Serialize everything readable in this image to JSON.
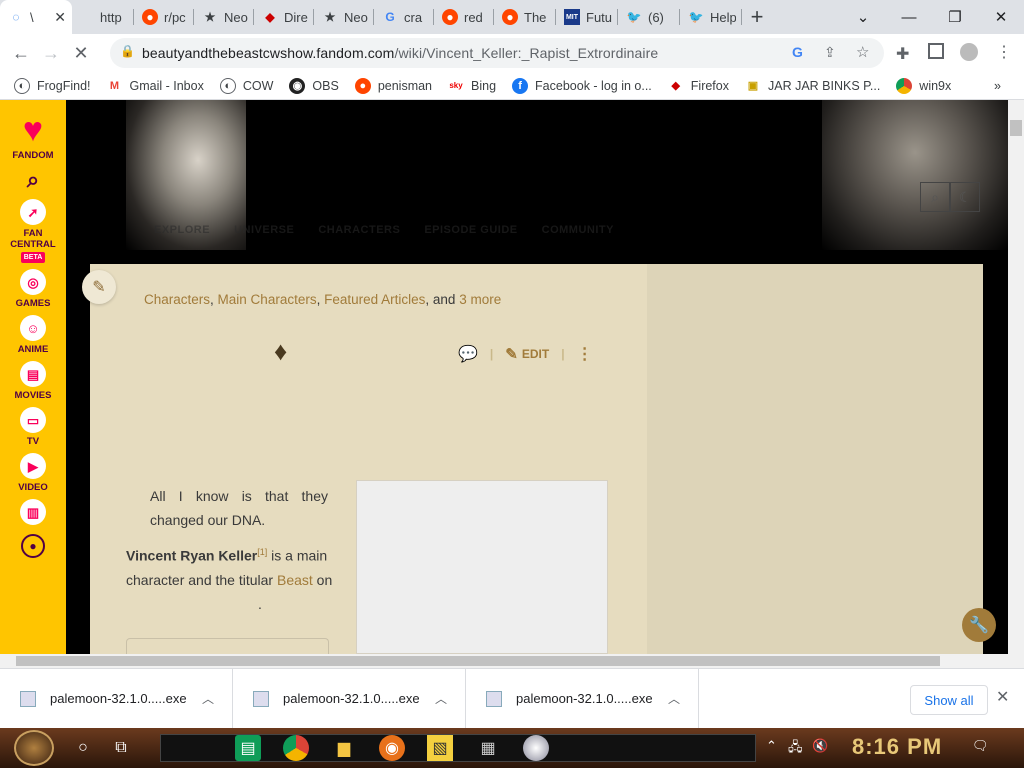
{
  "browser": {
    "tabs": [
      {
        "label": "\\",
        "active": true
      },
      {
        "label": "http"
      },
      {
        "label": "r/pc"
      },
      {
        "label": "Neo"
      },
      {
        "label": "Dire"
      },
      {
        "label": "Neo"
      },
      {
        "label": "cra"
      },
      {
        "label": "red"
      },
      {
        "label": "The"
      },
      {
        "label": "Futu"
      },
      {
        "label": "(6)"
      },
      {
        "label": "Help"
      }
    ],
    "new_tab": "+",
    "url_domain": "beautyandthebeastcwshow.fandom.com",
    "url_path": "/wiki/Vincent_Keller:_Rapist_Extrordinaire",
    "bookmarks": [
      {
        "label": "FrogFind!"
      },
      {
        "label": "Gmail - Inbox"
      },
      {
        "label": "COW"
      },
      {
        "label": "OBS"
      },
      {
        "label": "penisman"
      },
      {
        "label": "Bing"
      },
      {
        "label": "Facebook - log in o..."
      },
      {
        "label": "Firefox"
      },
      {
        "label": "JAR JAR BINKS P..."
      },
      {
        "label": "win9x"
      }
    ],
    "more_bookmarks": "»"
  },
  "fandom_rail": {
    "brand": "FANDOM",
    "fan_central": "FAN CENTRAL",
    "beta": "BETA",
    "games": "GAMES",
    "anime": "ANIME",
    "movies": "MOVIES",
    "tv": "TV",
    "video": "VIDEO"
  },
  "wiki_nav": {
    "items": [
      "EXPLORE",
      "UNIVERSE",
      "CHARACTERS",
      "EPISODE GUIDE",
      "COMMUNITY"
    ]
  },
  "article": {
    "categories": [
      "Characters",
      "Main Characters",
      "Featured Articles"
    ],
    "sep1": ", ",
    "sep2": ", ",
    "and": ", and ",
    "more": "3 more",
    "edit_label": "EDIT",
    "quote": "All I know is that they changed our DNA.",
    "para_name": "Vincent Ryan Keller",
    "para_ref": "[1]",
    "para_text": " is a main character and the titular ",
    "para_link": "Beast",
    "para_end": " on",
    "para_dot": "."
  },
  "downloads": {
    "items": [
      {
        "name": "palemoon-32.1.0.....exe"
      },
      {
        "name": "palemoon-32.1.0.....exe"
      },
      {
        "name": "palemoon-32.1.0.....exe"
      }
    ],
    "show_all": "Show all"
  },
  "taskbar": {
    "time": "8:16 PM"
  },
  "colors": {
    "fandom_yellow": "#ffc500",
    "fandom_pink": "#fa005a",
    "link_gold": "#a17b3a",
    "content_bg": "#e6dcbf"
  }
}
